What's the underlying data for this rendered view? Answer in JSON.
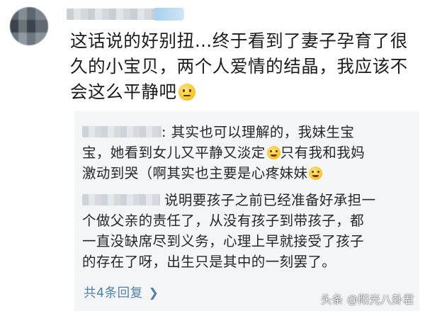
{
  "comment": {
    "line1": "这话说的好别扭…终于看到了妻子孕育了很",
    "line2": "久的小宝贝，两个人爱情的结晶，我应该不",
    "line3": "会这么平静吧",
    "emoji_icon": "neutral-face-emoji"
  },
  "replies": [
    {
      "separator": ":",
      "line1": " 其实也可以理解的，我妹生宝",
      "line2": "宝，她看到女儿又平静又淡定",
      "line2b": "只有我和我妈",
      "line3": "激动到哭（啊其实也主要是心疼妹妹",
      "emoji_icons": [
        "tears-of-joy-emoji",
        "tears-of-joy-emoji"
      ]
    },
    {
      "line1": "说明要孩子之前已经准备好承担一",
      "line2": "个做父亲的责任了，从没有孩子到带孩子，都",
      "line3": "一直没缺席尽到义务，心理上早就接受了孩子",
      "line4": "的存在了呀，出生只是其中的一刻罢了。"
    }
  ],
  "more_replies": {
    "label": "共4条回复",
    "icon": "chevron-right-icon"
  },
  "watermark": "头条 @阳光八卦君",
  "colors": {
    "link": "#4f7fb0",
    "reply_bg": "#f4f5f7",
    "text": "#1e1e1e"
  }
}
